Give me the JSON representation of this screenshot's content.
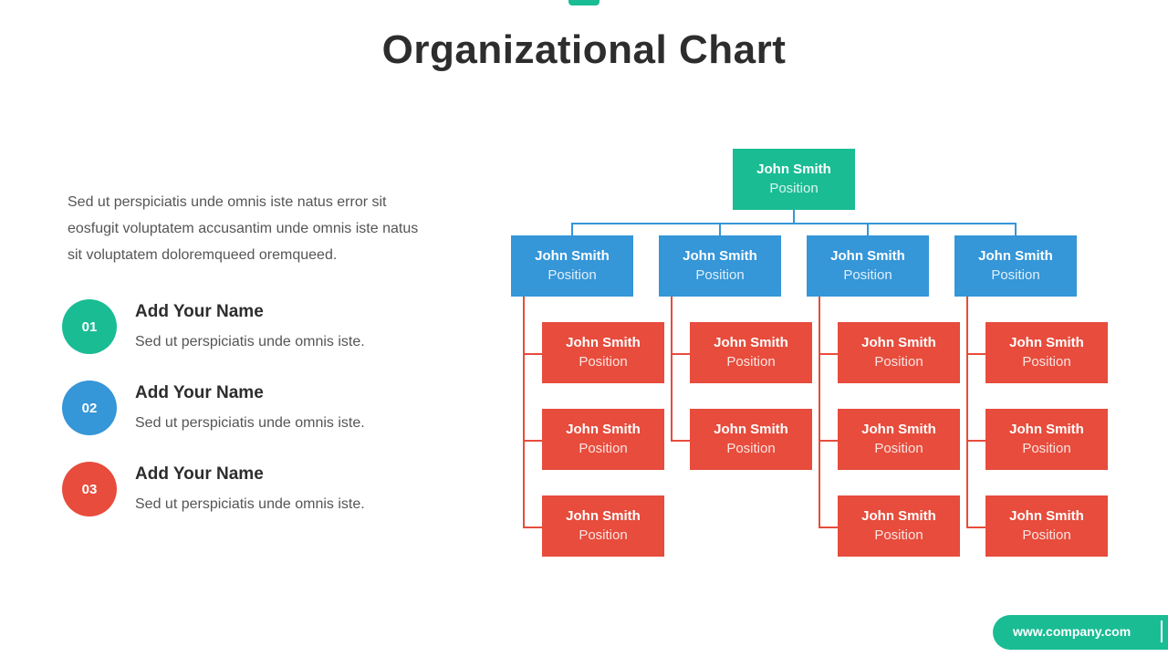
{
  "title": "Organizational Chart",
  "intro": "Sed ut perspiciatis unde omnis iste natus error sit eosfugit voluptatem accusantim unde omnis iste natus sit voluptatem doloremqueed oremqueed.",
  "items": [
    {
      "number": "01",
      "title": "Add Your Name",
      "desc": "Sed ut perspiciatis unde omnis iste.",
      "color": "#1abc94"
    },
    {
      "number": "02",
      "title": "Add Your Name",
      "desc": "Sed ut perspiciatis unde omnis iste.",
      "color": "#3596d8"
    },
    {
      "number": "03",
      "title": "Add Your Name",
      "desc": "Sed ut perspiciatis unde omnis iste.",
      "color": "#e74c3c"
    }
  ],
  "colors": {
    "root": "#1abc94",
    "manager": "#3596d8",
    "staff": "#e74c3c"
  },
  "org": {
    "root": {
      "name": "John Smith",
      "position": "Position"
    },
    "managers": [
      {
        "name": "John Smith",
        "position": "Position",
        "reports": [
          {
            "name": "John Smith",
            "position": "Position"
          },
          {
            "name": "John Smith",
            "position": "Position"
          },
          {
            "name": "John Smith",
            "position": "Position"
          }
        ]
      },
      {
        "name": "John Smith",
        "position": "Position",
        "reports": [
          {
            "name": "John Smith",
            "position": "Position"
          },
          {
            "name": "John Smith",
            "position": "Position"
          }
        ]
      },
      {
        "name": "John Smith",
        "position": "Position",
        "reports": [
          {
            "name": "John Smith",
            "position": "Position"
          },
          {
            "name": "John Smith",
            "position": "Position"
          },
          {
            "name": "John Smith",
            "position": "Position"
          }
        ]
      },
      {
        "name": "John Smith",
        "position": "Position",
        "reports": [
          {
            "name": "John Smith",
            "position": "Position"
          },
          {
            "name": "John Smith",
            "position": "Position"
          },
          {
            "name": "John Smith",
            "position": "Position"
          }
        ]
      }
    ]
  },
  "footer": {
    "url": "www.company.com"
  }
}
